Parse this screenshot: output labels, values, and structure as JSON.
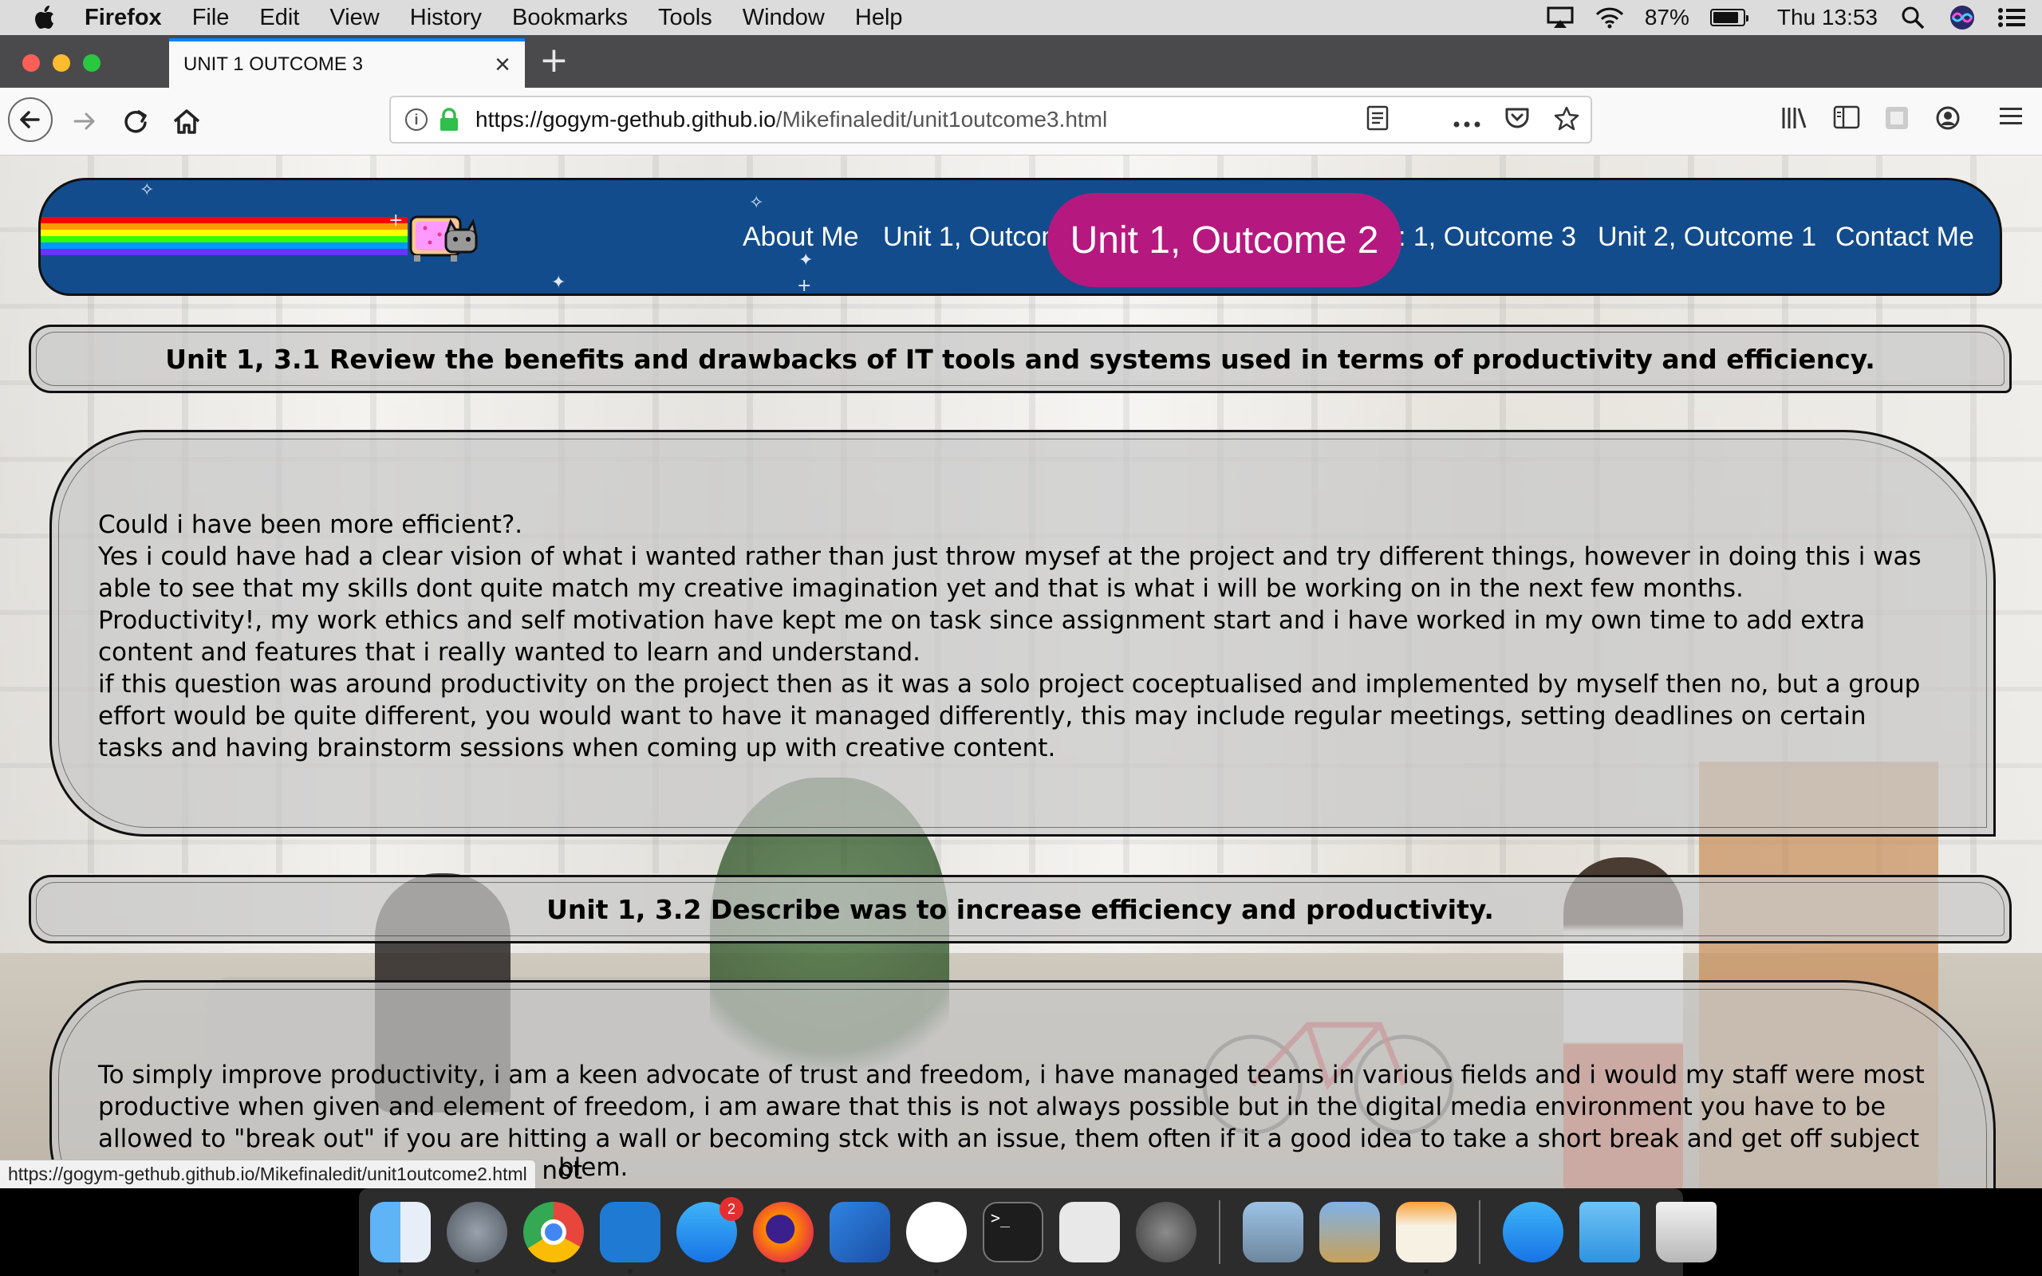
{
  "menubar": {
    "app_name": "Firefox",
    "items": [
      "File",
      "Edit",
      "View",
      "History",
      "Bookmarks",
      "Tools",
      "Window",
      "Help"
    ],
    "battery_percent": "87%",
    "battery_level": 0.87,
    "clock": "Thu 13:53",
    "icons": [
      "apple-icon",
      "airplay-icon",
      "wifi-icon",
      "battery-icon",
      "spotlight-icon",
      "siri-icon",
      "notification-center-icon"
    ]
  },
  "browser": {
    "tab_title": "UNIT 1 OUTCOME 3",
    "tab_close": "×",
    "new_tab": "+",
    "url_host": "https://gogym-gethub.github.io",
    "url_path": "/Mikefinaledit/unit1outcome3.html",
    "toolbar_icons": [
      "back-icon",
      "forward-icon",
      "reload-icon",
      "home-icon",
      "reader-view-icon",
      "page-actions-icon",
      "pocket-icon",
      "bookmark-star-icon",
      "library-icon",
      "sidebar-icon",
      "extension-icon",
      "account-icon",
      "hamburger-menu-icon"
    ]
  },
  "site": {
    "nav": {
      "about": "About Me",
      "u1o1": "Unit 1, Outcom",
      "u1o2_active": "Unit 1, Outcome 2",
      "u1o3": ": 1, Outcome 3",
      "u2o1": "Unit 2, Outcome 1",
      "contact": "Contact Me"
    },
    "section1": {
      "heading": "Unit 1, 3.1 Review the benefits and drawbacks of IT tools and systems used in terms of productivity and efficiency.",
      "lines": [
        "Could i have been more efficient?.",
        "Yes i could have had a clear vision of what i wanted rather than just throw mysef at the project and try different things, however in doing this i was able to see that my skills dont quite match my creative imagination yet and that is what i will be working on in the next few months.",
        "Productivity!, my work ethics and self motivation have kept me on task since assignment start and i have worked in my own time to add extra content and features that i really wanted to learn and understand.",
        "if this question was around productivity on the project then as it was a solo project coceptualised and implemented by myself then no, but a group effort would be quite different, you would want to have it managed differently, this may include regular meetings, setting deadlines on certain tasks and having brainstorm sessions when coming up with creative content."
      ]
    },
    "section2": {
      "heading": "Unit 1, 3.2 Describe was to increase efficiency and productivity.",
      "text": "To simply improve productivity, i am a keen advocate of trust and freedom, i have managed teams in various fields and i would my staff were most productive when given and element of freedom, i am aware that this is not always possible but in the digital media environment you have to be allowed to \"break out\" if you are hitting a wall or becoming stck with an issue, them often if it a good idea to take a short break and get off subject so that you brain can allow itself to not",
      "tail": "blem."
    }
  },
  "status_bar": {
    "link": "https://gogym-gethub.github.io/Mikefinaledit/unit1outcome2.html"
  },
  "dock": {
    "apps": [
      "finder-icon",
      "launchpad-icon",
      "chrome-icon",
      "vscode-icon",
      "app-store-icon",
      "firefox-icon",
      "xcode-icon",
      "slack-icon",
      "terminal-icon",
      "screenshot-icon",
      "system-preferences-icon",
      "preview-icon",
      "mail-stamp-icon",
      "pages-icon",
      "app-store-folder-icon",
      "folder-icon",
      "trash-icon"
    ],
    "app_store_badge": "2"
  },
  "colors": {
    "header_blue": "#134c8c",
    "active_pink": "#b5197f",
    "tab_accent": "#0a84ff",
    "lock_green": "#2fbf4a"
  }
}
